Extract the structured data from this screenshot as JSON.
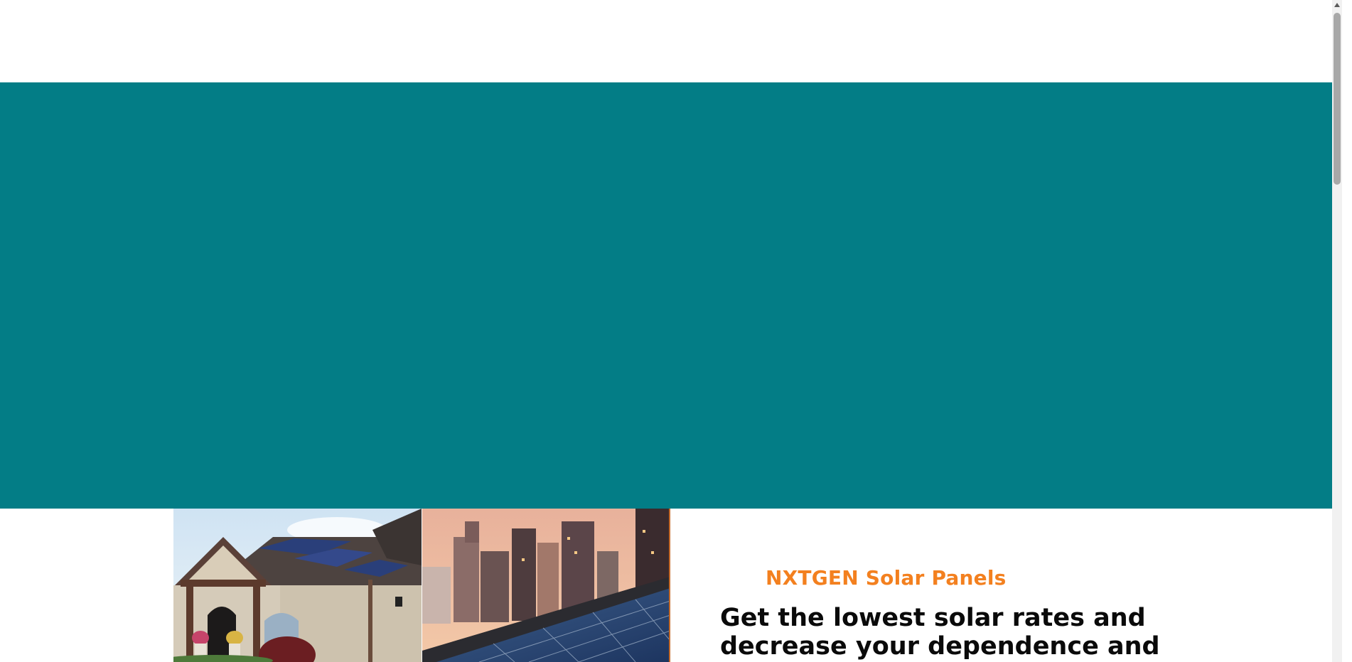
{
  "header": {},
  "hero": {
    "background_color": "#037d86"
  },
  "about": {
    "eyebrow": "NXTGEN Solar Panels",
    "headline": "Get the lowest solar rates and decrease your dependence and",
    "accent_color": "#f3801f",
    "images": [
      {
        "icon": "house-with-solar-roof-image"
      },
      {
        "icon": "city-skyline-solar-panels-image"
      }
    ]
  }
}
